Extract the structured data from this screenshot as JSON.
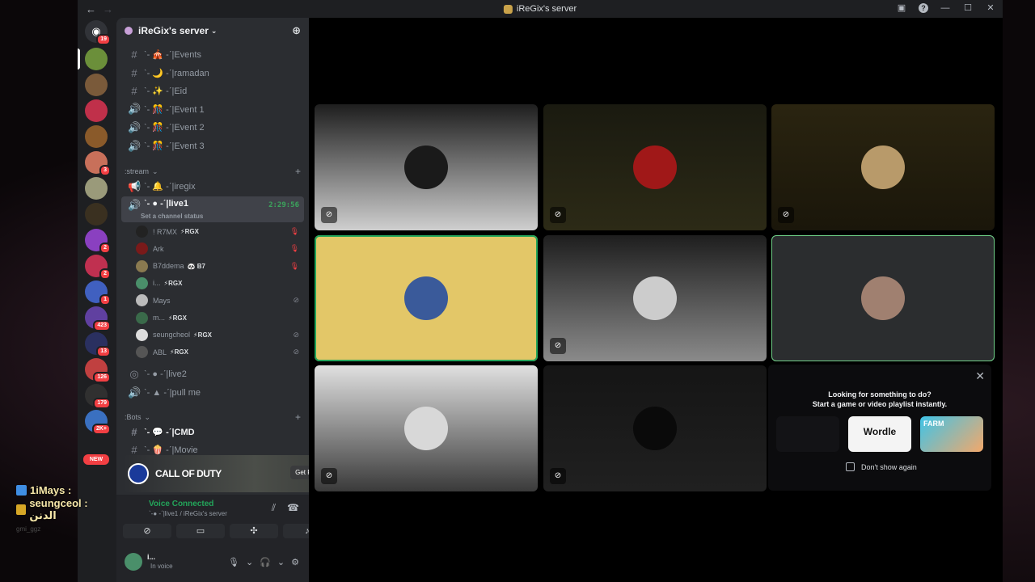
{
  "window": {
    "title": "iReGix's server"
  },
  "rail": {
    "home_badge": "19",
    "new_label": "NEW",
    "servers": [
      {
        "badge": "",
        "color": "#6b8f3a"
      },
      {
        "badge": "",
        "color": "#7a5a3a"
      },
      {
        "badge": "",
        "color": "#c0304a"
      },
      {
        "badge": "",
        "color": "#8a5a2a"
      },
      {
        "badge": "3",
        "color": "#c8705a"
      },
      {
        "badge": "",
        "color": "#9a9a7a"
      },
      {
        "badge": "",
        "color": "#3a3020"
      },
      {
        "badge": "2",
        "color": "#8a40c0"
      },
      {
        "badge": "2",
        "color": "#c03050"
      },
      {
        "badge": "1",
        "color": "#4060c0"
      },
      {
        "badge": "423",
        "color": "#6040a0"
      },
      {
        "badge": "13",
        "color": "#2a3060"
      },
      {
        "badge": "126",
        "color": "#c04040"
      },
      {
        "badge": "179",
        "color": "#303030"
      },
      {
        "badge": "2K+",
        "color": "#3a70c0"
      }
    ]
  },
  "sidebar": {
    "server_name": "iReGix's server",
    "channels_top": [
      {
        "icon": "#",
        "name": "ˋ- 🎪 -ˊ|Events"
      },
      {
        "icon": "#",
        "name": "ˋ- 🌙 -ˊ|ramadan"
      },
      {
        "icon": "#",
        "name": "ˋ- ✨ -ˊ|Eid"
      },
      {
        "icon": "🔊",
        "name": "ˋ- 🎊 -ˊ|Event 1"
      },
      {
        "icon": "🔊",
        "name": "ˋ- 🎊 -ˊ|Event 2"
      },
      {
        "icon": "🔊",
        "name": "ˋ- 🎊 -ˊ|Event 3"
      }
    ],
    "stream_category": ":stream",
    "stream_channels": {
      "iregix": "ˋ- 🔔 -ˊ|iregix",
      "live1": "ˋ- ● -ˊ|live1",
      "live1_timer": "2:29:56",
      "live1_status": "Set a channel status",
      "live2": "ˋ- ● -ˊ|live2",
      "pullme": "ˋ- ▲ -ˊ|pull me"
    },
    "voice_users": [
      {
        "name": "! R7MX",
        "tag": "⚡RGX",
        "mic": "red",
        "color": "#222"
      },
      {
        "name": "Ark",
        "tag": "",
        "mic": "red",
        "color": "#7a1a1a"
      },
      {
        "name": "B7ddema",
        "tag": "🐼 B7",
        "mic": "red",
        "color": "#8a7a50"
      },
      {
        "name": "i...",
        "tag": "⚡RGX",
        "mic": "",
        "color": "#4a8f6a"
      },
      {
        "name": "Mays",
        "tag": "",
        "mic": "grey",
        "color": "#bbb"
      },
      {
        "name": "m...",
        "tag": "⚡RGX",
        "mic": "",
        "color": "#3a6a4a"
      },
      {
        "name": "seungcheol",
        "tag": "⚡RGX",
        "mic": "grey",
        "color": "#ddd"
      },
      {
        "name": "ABL",
        "tag": "⚡RGX",
        "mic": "grey",
        "color": "#555"
      }
    ],
    "bots_category": ":Bots",
    "bot_channels": {
      "cmd": "ˋ- 💬 -ˊ|CMD",
      "movie": "ˋ- 🍿 -ˊ|Movie"
    }
  },
  "promo": {
    "title": "CALL OF DUTY",
    "button": "Get Reward!"
  },
  "voice": {
    "status": "Voice Connected",
    "location": "ˋ-● -ˊ|live1 / iReGix's server"
  },
  "user": {
    "name": "i...",
    "status": "In voice"
  },
  "tiles": [
    {
      "bg": "linear-gradient(180deg,#1e1e1e 0%,#cfcfcf 100%)",
      "av": "#1a1a1a",
      "mute": true,
      "speaking": ""
    },
    {
      "bg": "linear-gradient(180deg,#1a1a10 0%,#2c2a16 100%)",
      "av": "#a01818",
      "mute": true,
      "speaking": ""
    },
    {
      "bg": "linear-gradient(180deg,#2a2410 0%,#1a160a 100%)",
      "av": "#b89a6a",
      "mute": true,
      "speaking": ""
    },
    {
      "bg": "#e3c768",
      "av": "#3a5a9a",
      "mute": false,
      "speaking": "speaking"
    },
    {
      "bg": "linear-gradient(180deg,#1e1e1e 0%,#8a8a8a 100%)",
      "av": "#ccc",
      "mute": true,
      "speaking": ""
    },
    {
      "bg": "#2b2d2f",
      "av": "#a08070",
      "mute": false,
      "speaking": "speaking-light"
    },
    {
      "bg": "linear-gradient(180deg,#e0e0e0 0%,#3a3a3a 100%)",
      "av": "#d8d8d8",
      "mute": true,
      "speaking": ""
    },
    {
      "bg": "linear-gradient(180deg,#151515 0%,#202020 100%)",
      "av": "#0a0a0a",
      "mute": true,
      "speaking": ""
    }
  ],
  "activity": {
    "line1": "Looking for something to do?",
    "line2": "Start a game or video playlist instantly.",
    "game2": "Wordle",
    "game3": "FARM",
    "dont_show": "Don't show again"
  },
  "overlay_chat": [
    {
      "text": "1iMays :",
      "icon": "blue"
    },
    {
      "text": "seungceol : الدنن",
      "icon": "gold"
    }
  ],
  "overlay_faint": "gmi_ggz"
}
